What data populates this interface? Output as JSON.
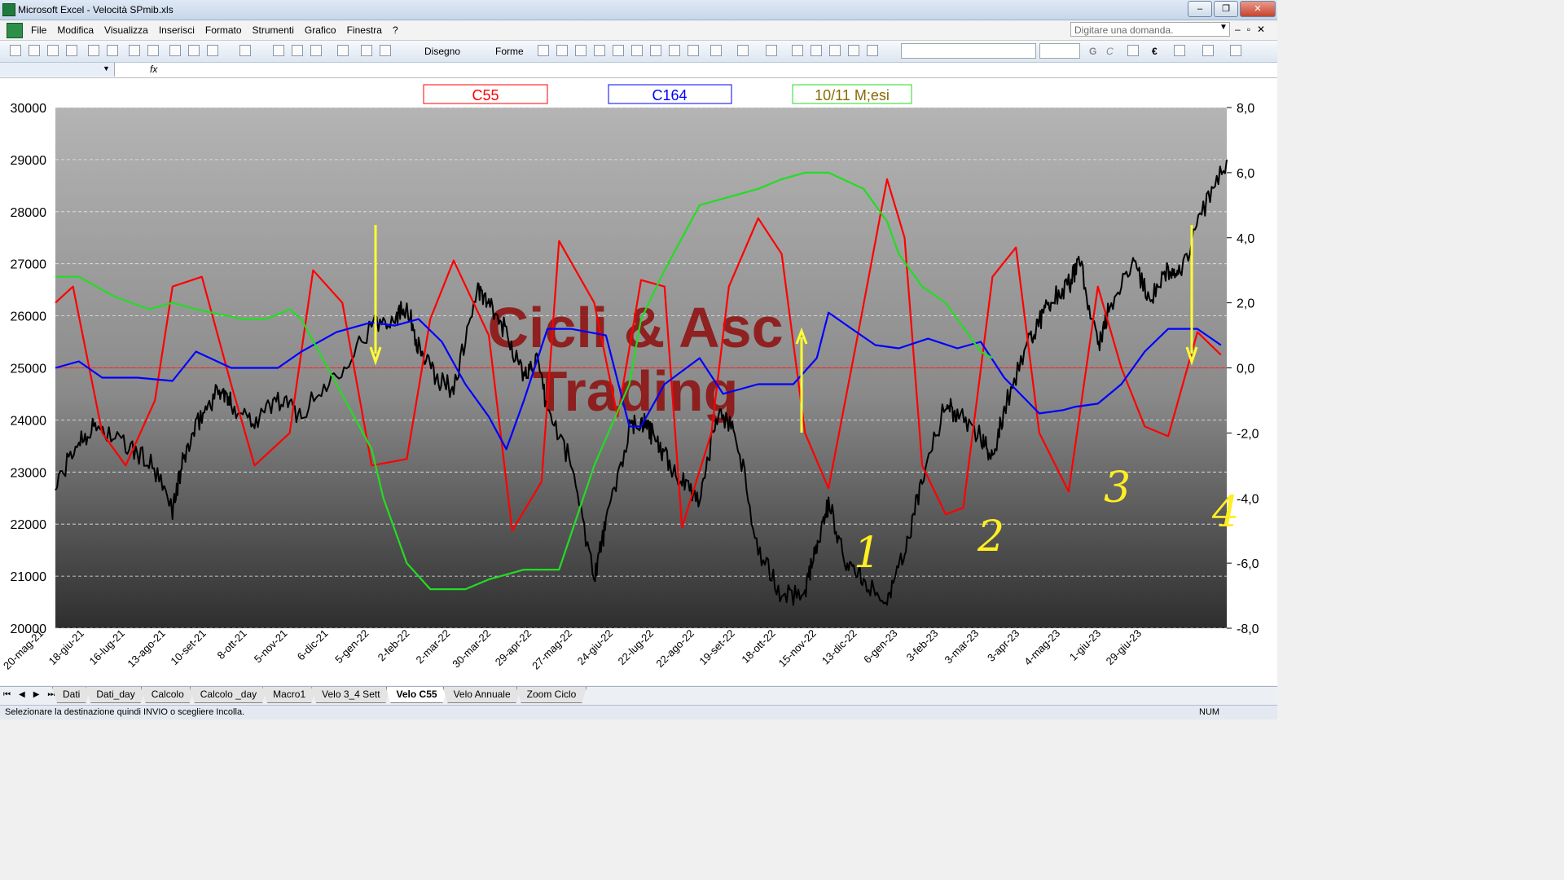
{
  "window": {
    "title": "Microsoft Excel - Velocità SPmib.xls",
    "min": "–",
    "max": "❐",
    "close": "✕"
  },
  "menu": [
    "File",
    "Modifica",
    "Visualizza",
    "Inserisci",
    "Formato",
    "Strumenti",
    "Grafico",
    "Finestra",
    "?"
  ],
  "ask_box": {
    "placeholder": "Digitare una domanda.",
    "doc_controls": [
      "–",
      "▫",
      "✕"
    ]
  },
  "toolbar": {
    "drawing_label": "Disegno",
    "shapes_label": "Forme",
    "bold": "G",
    "italic": "C",
    "euro": "€"
  },
  "formula_bar": {
    "fx": "fx"
  },
  "chart_data": {
    "type": "line",
    "title": "",
    "watermark": [
      "Cicli & Asc",
      "Trading"
    ],
    "legend": [
      "C55",
      "C164",
      "10/11 M;esi"
    ],
    "x_ticks": [
      "20-mag-21",
      "18-giu-21",
      "16-lug-21",
      "13-ago-21",
      "10-set-21",
      "8-ott-21",
      "5-nov-21",
      "6-dic-21",
      "5-gen-22",
      "2-feb-22",
      "2-mar-22",
      "30-mar-22",
      "29-apr-22",
      "27-mag-22",
      "24-giu-22",
      "22-lug-22",
      "22-ago-22",
      "19-set-22",
      "18-ott-22",
      "15-nov-22",
      "13-dic-22",
      "6-gen-23",
      "3-feb-23",
      "3-mar-23",
      "3-apr-23",
      "4-mag-23",
      "1-giu-23",
      "29-giu-23"
    ],
    "y_left": {
      "min": 20000,
      "max": 30000,
      "ticks": [
        "30000",
        "29000",
        "28000",
        "27000",
        "26000",
        "25000",
        "24000",
        "23000",
        "22000",
        "21000",
        "20000"
      ]
    },
    "y_right": {
      "min": -8,
      "max": 8,
      "ticks": [
        "8,0",
        "6,0",
        "4,0",
        "2,0",
        "0,0",
        "-2,0",
        "-4,0",
        "-6,0",
        "-8,0"
      ]
    },
    "grid": true,
    "series": [
      {
        "name": "",
        "axis": "left",
        "color": "#000000",
        "x": [
          0,
          0.02,
          0.035,
          0.06,
          0.08,
          0.1,
          0.11,
          0.125,
          0.14,
          0.15,
          0.17,
          0.19,
          0.21,
          0.24,
          0.27,
          0.29,
          0.3,
          0.31,
          0.325,
          0.34,
          0.36,
          0.37,
          0.385,
          0.4,
          0.41,
          0.42,
          0.44,
          0.46,
          0.47,
          0.49,
          0.5,
          0.51,
          0.52,
          0.535,
          0.55,
          0.565,
          0.58,
          0.6,
          0.62,
          0.64,
          0.65,
          0.66,
          0.675,
          0.69,
          0.71,
          0.725,
          0.74,
          0.76,
          0.77,
          0.79,
          0.8,
          0.81,
          0.83,
          0.84,
          0.85,
          0.865,
          0.875,
          0.89,
          0.9,
          0.92,
          0.935,
          0.95,
          0.96,
          0.98,
          1.0
        ],
        "values": [
          22700,
          23600,
          23900,
          23500,
          23200,
          22300,
          23300,
          24100,
          24600,
          24300,
          24000,
          24400,
          24100,
          24900,
          25800,
          26000,
          26200,
          25400,
          24800,
          24600,
          26500,
          26200,
          25700,
          24800,
          25200,
          24200,
          23200,
          21000,
          22000,
          23800,
          24000,
          23700,
          23300,
          22800,
          22500,
          24100,
          23900,
          21500,
          20600,
          20700,
          21600,
          22400,
          21300,
          20900,
          20600,
          21400,
          22900,
          24300,
          24100,
          23700,
          23300,
          24200,
          25500,
          25900,
          26300,
          26600,
          27000,
          25400,
          26200,
          27000,
          26300,
          26900,
          26800,
          28000,
          29000
        ]
      },
      {
        "name": "C55",
        "axis": "right",
        "color": "#ff0000",
        "x": [
          0,
          0.015,
          0.04,
          0.06,
          0.085,
          0.1,
          0.125,
          0.15,
          0.17,
          0.2,
          0.22,
          0.245,
          0.27,
          0.3,
          0.32,
          0.34,
          0.37,
          0.39,
          0.415,
          0.43,
          0.46,
          0.48,
          0.5,
          0.52,
          0.535,
          0.56,
          0.575,
          0.6,
          0.62,
          0.64,
          0.66,
          0.685,
          0.71,
          0.725,
          0.74,
          0.76,
          0.775,
          0.8,
          0.82,
          0.84,
          0.865,
          0.89,
          0.91,
          0.93,
          0.95,
          0.975,
          0.995
        ],
        "values": [
          2.0,
          2.5,
          -2.0,
          -3.0,
          -1.0,
          2.5,
          2.8,
          -0.5,
          -3.0,
          -2.0,
          3.0,
          2.0,
          -3.0,
          -2.8,
          1.5,
          3.3,
          1.0,
          -5.0,
          -3.5,
          3.9,
          2.0,
          -1.5,
          2.7,
          2.5,
          -4.9,
          -2.0,
          2.5,
          4.6,
          3.5,
          -2.0,
          -3.7,
          1.0,
          5.8,
          4.0,
          -3.0,
          -4.5,
          -4.3,
          2.8,
          3.7,
          -2.0,
          -3.8,
          2.5,
          0.0,
          -1.8,
          -2.1,
          1.1,
          0.4
        ]
      },
      {
        "name": "C164",
        "axis": "right",
        "color": "#0000ff",
        "x": [
          0,
          0.02,
          0.04,
          0.07,
          0.1,
          0.12,
          0.15,
          0.19,
          0.21,
          0.24,
          0.27,
          0.29,
          0.31,
          0.33,
          0.35,
          0.37,
          0.385,
          0.4,
          0.42,
          0.44,
          0.47,
          0.49,
          0.5,
          0.52,
          0.55,
          0.57,
          0.6,
          0.63,
          0.65,
          0.66,
          0.68,
          0.7,
          0.72,
          0.745,
          0.77,
          0.79,
          0.81,
          0.84,
          0.86,
          0.87,
          0.89,
          0.91,
          0.93,
          0.95,
          0.975,
          0.995
        ],
        "values": [
          0.0,
          0.2,
          -0.3,
          -0.3,
          -0.4,
          0.5,
          0.0,
          0.0,
          0.5,
          1.1,
          1.4,
          1.3,
          1.5,
          0.8,
          -0.5,
          -1.5,
          -2.5,
          -1.0,
          1.2,
          1.2,
          1.0,
          -1.8,
          -1.8,
          -0.5,
          0.3,
          -0.8,
          -0.5,
          -0.5,
          0.3,
          1.7,
          1.2,
          0.7,
          0.6,
          0.9,
          0.6,
          0.8,
          -0.3,
          -1.4,
          -1.3,
          -1.2,
          -1.1,
          -0.5,
          0.5,
          1.2,
          1.2,
          0.7
        ]
      },
      {
        "name": "10/11 M;esi",
        "axis": "right",
        "color": "#22dd22",
        "x": [
          0,
          0.02,
          0.05,
          0.08,
          0.1,
          0.12,
          0.16,
          0.18,
          0.2,
          0.21,
          0.24,
          0.27,
          0.28,
          0.3,
          0.32,
          0.34,
          0.35,
          0.37,
          0.4,
          0.43,
          0.46,
          0.49,
          0.5,
          0.52,
          0.55,
          0.58,
          0.6,
          0.62,
          0.64,
          0.66,
          0.69,
          0.7,
          0.71,
          0.72,
          0.74,
          0.76,
          0.78,
          0.79,
          0.8
        ],
        "values": [
          2.8,
          2.8,
          2.2,
          1.8,
          2.0,
          1.8,
          1.5,
          1.5,
          1.8,
          1.5,
          -0.5,
          -2.5,
          -4.0,
          -6.0,
          -6.8,
          -6.8,
          -6.8,
          -6.5,
          -6.2,
          -6.2,
          -3.0,
          -0.5,
          1.5,
          3.0,
          5.0,
          5.3,
          5.5,
          5.8,
          6.0,
          6.0,
          5.5,
          5.0,
          4.5,
          3.5,
          2.5,
          2.0,
          1.0,
          0.5,
          0.3
        ]
      }
    ],
    "annotations": [
      "1",
      "2",
      "3",
      "4"
    ]
  },
  "sheet_tabs": [
    "Dati",
    "Dati_day",
    "Calcolo",
    "Calcolo _day",
    "Macro1",
    "Velo 3_4 Sett",
    "Velo C55",
    "Velo Annuale",
    "Zoom Ciclo"
  ],
  "active_tab": "Velo C55",
  "status": {
    "message": "Selezionare la destinazione quindi INVIO o scegliere Incolla.",
    "num": "NUM"
  }
}
